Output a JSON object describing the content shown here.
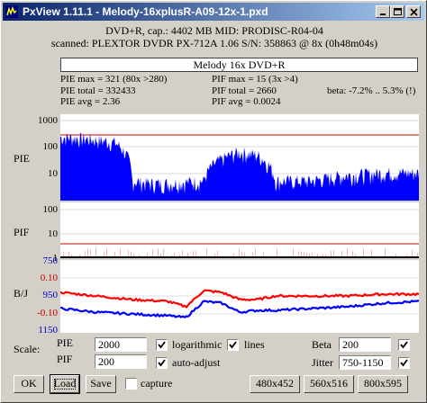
{
  "window": {
    "title": "PxView 1.11.1  -  Melody-16xplusR-A09-12x-1.pxd"
  },
  "header": {
    "line1": "DVD+R, cap.: 4402 MB MID: PRODISC-R04-04",
    "line2": "scanned: PLEXTOR DVDR PX-712A 1.06 S/N: 358863 @ 8x (0h48m04s)",
    "disc_name": "Melody 16x DVD+R"
  },
  "stats": {
    "pie_max": "PIE max = 321 (80x >280)",
    "pie_total": "PIE total = 332433",
    "pie_avg": "PIE avg = 2.36",
    "pif_max": "PIF max = 15 (3x >4)",
    "pif_total": "PIF total = 2660",
    "pif_avg": "PIF avg = 0.0024",
    "beta": "beta: -7.2% .. 5.3% (!)"
  },
  "plots": {
    "pie_label": "PIE",
    "pif_label": "PIF",
    "bj_label": "B/J",
    "pie_ticks": [
      "1000",
      "100",
      "10"
    ],
    "pif_ticks": [
      "100",
      "10",
      "1"
    ],
    "bj_ticks": [
      "750",
      "0.10",
      "950",
      "-0.10",
      "1150"
    ]
  },
  "chart_data": [
    {
      "type": "area",
      "title": "PIE",
      "yscale": "log",
      "ylim": [
        1,
        1000
      ],
      "x": [
        0,
        5,
        10,
        15,
        20,
        25,
        30,
        40,
        50,
        55,
        60,
        65,
        70,
        80,
        90,
        100
      ],
      "values": [
        220,
        200,
        170,
        140,
        5,
        4,
        4,
        5,
        60,
        45,
        5,
        5,
        5,
        8,
        10,
        10
      ],
      "threshold": 280,
      "color": "#0000ff"
    },
    {
      "type": "area",
      "title": "PIF",
      "yscale": "log",
      "ylim": [
        1,
        100
      ],
      "threshold": 4,
      "color": "#ff8080"
    },
    {
      "type": "line",
      "title": "B/J",
      "series": [
        {
          "color": "#ff0000",
          "x": [
            0,
            10,
            20,
            30,
            35,
            40,
            45,
            50,
            55,
            60,
            70,
            80,
            90,
            100
          ],
          "values": [
            0.02,
            0.0,
            -0.02,
            -0.03,
            -0.06,
            0.03,
            0.02,
            -0.02,
            -0.02,
            0.0,
            0.0,
            0.0,
            0.01,
            0.01
          ]
        },
        {
          "color": "#0000ff",
          "x": [
            0,
            10,
            20,
            30,
            35,
            40,
            45,
            50,
            55,
            60,
            70,
            80,
            90,
            100
          ],
          "values": [
            -0.07,
            -0.09,
            -0.1,
            -0.11,
            -0.12,
            -0.03,
            -0.04,
            -0.09,
            -0.08,
            -0.08,
            -0.07,
            -0.06,
            -0.04,
            -0.03
          ]
        }
      ]
    }
  ],
  "controls": {
    "scale_label": "Scale:",
    "pie_label": "PIE",
    "pie_value": "2000",
    "pif_label": "PIF",
    "pif_value": "200",
    "logarithmic_label": "logarithmic",
    "lines_label": "lines",
    "auto_adjust_label": "auto-adjust",
    "beta_label": "Beta",
    "beta_value": "200",
    "jitter_label": "Jitter",
    "jitter_value": "750-1150",
    "capture_label": "capture"
  },
  "buttons": {
    "ok": "OK",
    "load": "Load",
    "save": "Save",
    "size1": "480x452",
    "size2": "560x516",
    "size3": "800x595"
  }
}
